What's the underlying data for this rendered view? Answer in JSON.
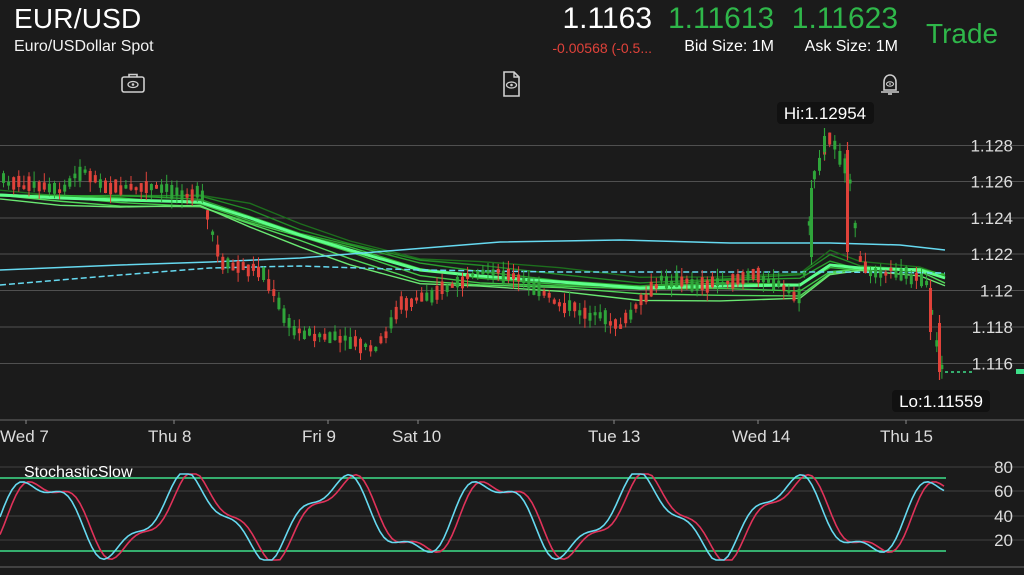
{
  "header": {
    "symbol": "EUR/USD",
    "description": "Euro/USDollar Spot",
    "last_price": "1.1163",
    "change": "-0.00568 (-0.5...",
    "bid": "1.11613",
    "bid_size": "Bid Size: 1M",
    "ask": "1.11623",
    "ask_size": "Ask Size: 1M",
    "trade_label": "Trade"
  },
  "toolbar": {
    "icons": [
      "portfolio-eye-icon",
      "document-eye-icon",
      "alert-bell-icon"
    ]
  },
  "colors": {
    "background": "#1b1b1b",
    "up_candle": "#2fa53a",
    "down_candle": "#e0423a",
    "ma_bright": "#5dff8a",
    "bollinger": "#66d9f0",
    "stoch_k": "#66d9f0",
    "stoch_d": "#e0325a",
    "stoch_band": "#3ee08a"
  },
  "price_chart": {
    "high_label": "Hi:1.12954",
    "low_label": "Lo:1.11559",
    "y_ticks": [
      "1.128",
      "1.126",
      "1.124",
      "1.122",
      "1.12",
      "1.118",
      "1.116"
    ],
    "x_labels": [
      "Wed 7",
      "Thu 8",
      "Fri 9",
      "Sat 10",
      "Tue 13",
      "Wed 14",
      "Thu 15"
    ]
  },
  "indicator": {
    "name": "StochasticSlow",
    "y_ticks": [
      "80",
      "60",
      "40",
      "20"
    ]
  },
  "chart_data": {
    "type": "candlestick",
    "high": 1.12954,
    "low": 1.11559,
    "ylim": [
      1.1145,
      1.1295
    ],
    "overbought": 80,
    "oversold": 20
  }
}
